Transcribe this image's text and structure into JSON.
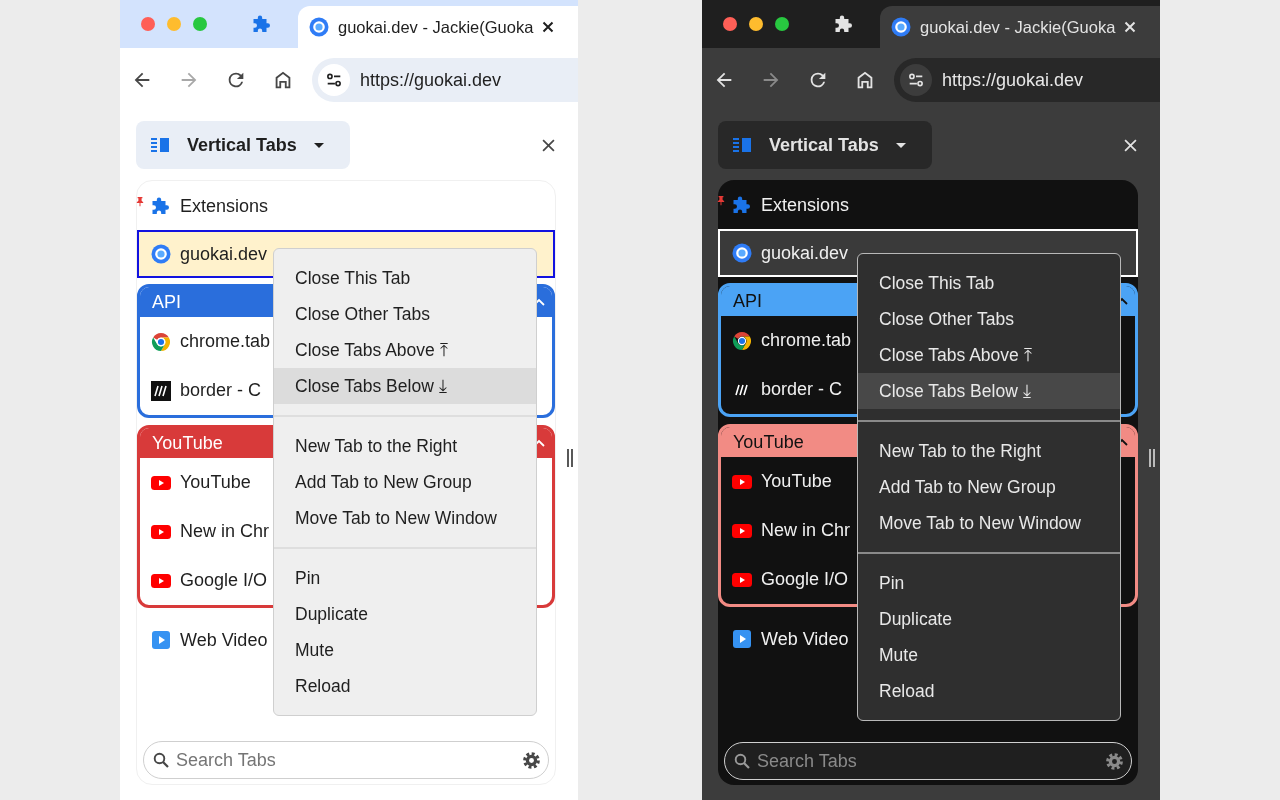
{
  "panels": [
    {
      "dark_mode": false,
      "tab_strip": {
        "tab_title": "guokai.dev - Jackie(Guoka"
      },
      "toolbar": {
        "buttons": [
          {
            "kind": "back",
            "disabled": false
          },
          {
            "kind": "forward",
            "disabled": true
          },
          {
            "kind": "reload",
            "disabled": false
          },
          {
            "kind": "home",
            "disabled": false
          }
        ],
        "url": "https://guokai.dev"
      },
      "side_panel": {
        "title": "Vertical Tabs",
        "tabs": [
          {
            "kind": "tab",
            "favicon": {
              "kind": "puzzle"
            },
            "title": "Extensions",
            "pinned": true,
            "selected": false
          },
          {
            "kind": "tab",
            "favicon": {
              "kind": "guokai"
            },
            "title": "guokai.dev",
            "pinned": false,
            "selected": true
          },
          {
            "kind": "group",
            "name": "API",
            "color": "#2a6edc",
            "expanded": true,
            "children": [
              {
                "kind": "tab",
                "favicon": {
                  "kind": "chrome"
                },
                "title": "chrome.tab",
                "pinned": false,
                "selected": false
              },
              {
                "kind": "tab",
                "favicon": {
                  "kind": "mdn"
                },
                "title": "border - C",
                "pinned": false,
                "selected": false
              }
            ]
          },
          {
            "kind": "group",
            "name": "YouTube",
            "color": "#d83a3a",
            "expanded": true,
            "children": [
              {
                "kind": "tab",
                "favicon": {
                  "kind": "youtube"
                },
                "title": "YouTube",
                "pinned": false,
                "selected": false
              },
              {
                "kind": "tab",
                "favicon": {
                  "kind": "youtube"
                },
                "title": "New in Chr",
                "pinned": false,
                "selected": false
              },
              {
                "kind": "tab",
                "favicon": {
                  "kind": "youtube"
                },
                "title": "Google I/O",
                "pinned": false,
                "selected": false
              }
            ]
          },
          {
            "kind": "tab",
            "favicon": {
              "kind": "video"
            },
            "title": "Web Video",
            "pinned": false,
            "selected": false
          }
        ],
        "search": {
          "placeholder": "Search Tabs"
        }
      },
      "context_menu": {
        "sections": [
          {
            "items": [
              {
                "label": "Close This Tab",
                "selected": false
              },
              {
                "label": "Close Other Tabs",
                "selected": false
              },
              {
                "label": "Close Tabs Above ⤒",
                "selected": false
              },
              {
                "label": "Close Tabs Below ⤓",
                "selected": true
              }
            ]
          },
          {
            "items": [
              {
                "label": "New Tab to the Right",
                "selected": false
              },
              {
                "label": "Add Tab to New Group",
                "selected": false
              },
              {
                "label": "Move Tab to New Window",
                "selected": false
              }
            ]
          },
          {
            "items": [
              {
                "label": "Pin",
                "selected": false
              },
              {
                "label": "Duplicate",
                "selected": false
              },
              {
                "label": "Mute",
                "selected": false
              },
              {
                "label": "Reload",
                "selected": false
              }
            ]
          }
        ]
      }
    },
    {
      "dark_mode": true,
      "tab_strip": {
        "tab_title": "guokai.dev - Jackie(Guoka"
      },
      "toolbar": {
        "buttons": [
          {
            "kind": "back",
            "disabled": false
          },
          {
            "kind": "forward",
            "disabled": true
          },
          {
            "kind": "reload",
            "disabled": false
          },
          {
            "kind": "home",
            "disabled": false
          }
        ],
        "url": "https://guokai.dev"
      },
      "side_panel": {
        "title": "Vertical Tabs",
        "tabs": [
          {
            "kind": "tab",
            "favicon": {
              "kind": "puzzle"
            },
            "title": "Extensions",
            "pinned": true,
            "selected": false
          },
          {
            "kind": "tab",
            "favicon": {
              "kind": "guokai"
            },
            "title": "guokai.dev",
            "pinned": false,
            "selected": true
          },
          {
            "kind": "group",
            "name": "API",
            "color": "#4ba3f5",
            "expanded": true,
            "children": [
              {
                "kind": "tab",
                "favicon": {
                  "kind": "chrome"
                },
                "title": "chrome.tab",
                "pinned": false,
                "selected": false
              },
              {
                "kind": "tab",
                "favicon": {
                  "kind": "mdn"
                },
                "title": "border - C",
                "pinned": false,
                "selected": false
              }
            ]
          },
          {
            "kind": "group",
            "name": "YouTube",
            "color": "#f28b84",
            "expanded": true,
            "children": [
              {
                "kind": "tab",
                "favicon": {
                  "kind": "youtube"
                },
                "title": "YouTube",
                "pinned": false,
                "selected": false
              },
              {
                "kind": "tab",
                "favicon": {
                  "kind": "youtube"
                },
                "title": "New in Chr",
                "pinned": false,
                "selected": false
              },
              {
                "kind": "tab",
                "favicon": {
                  "kind": "youtube"
                },
                "title": "Google I/O",
                "pinned": false,
                "selected": false
              }
            ]
          },
          {
            "kind": "tab",
            "favicon": {
              "kind": "video"
            },
            "title": "Web Video",
            "pinned": false,
            "selected": false
          }
        ],
        "search": {
          "placeholder": "Search Tabs"
        }
      },
      "context_menu": {
        "sections": [
          {
            "items": [
              {
                "label": "Close This Tab",
                "selected": false
              },
              {
                "label": "Close Other Tabs",
                "selected": false
              },
              {
                "label": "Close Tabs Above ⤒",
                "selected": false
              },
              {
                "label": "Close Tabs Below ⤓",
                "selected": true
              }
            ]
          },
          {
            "items": [
              {
                "label": "New Tab to the Right",
                "selected": false
              },
              {
                "label": "Add Tab to New Group",
                "selected": false
              },
              {
                "label": "Move Tab to New Window",
                "selected": false
              }
            ]
          },
          {
            "items": [
              {
                "label": "Pin",
                "selected": false
              },
              {
                "label": "Duplicate",
                "selected": false
              },
              {
                "label": "Mute",
                "selected": false
              },
              {
                "label": "Reload",
                "selected": false
              }
            ]
          }
        ]
      }
    }
  ]
}
